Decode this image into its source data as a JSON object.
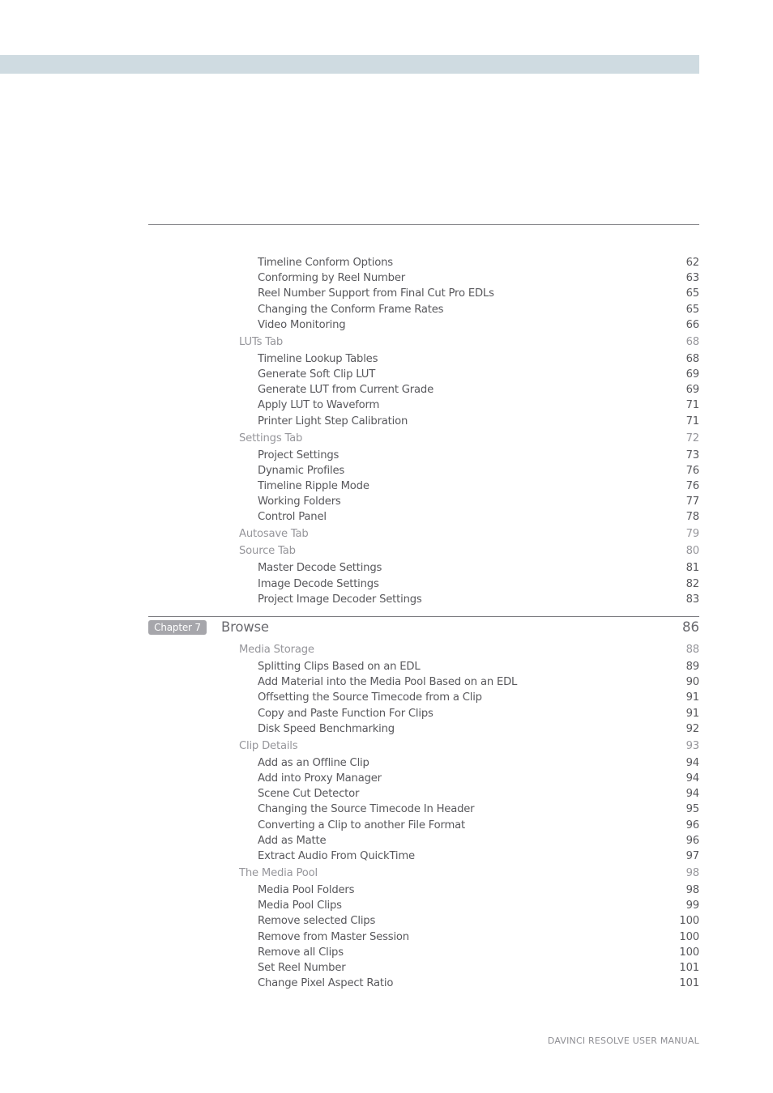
{
  "header": {
    "band_color": "#cfdbe1"
  },
  "toc_before": [
    {
      "level": "sub",
      "title": "Timeline Conform Options",
      "page": "62"
    },
    {
      "level": "sub",
      "title": "Conforming by Reel Number",
      "page": "63"
    },
    {
      "level": "sub",
      "title": "Reel Number Support from Final Cut Pro EDLs",
      "page": "65"
    },
    {
      "level": "sub",
      "title": "Changing the Conform Frame Rates",
      "page": "65"
    },
    {
      "level": "sub",
      "title": "Video Monitoring",
      "page": "66"
    },
    {
      "level": "sec",
      "title": "LUTs Tab",
      "page": "68"
    },
    {
      "level": "sub",
      "title": "Timeline Lookup Tables",
      "page": "68"
    },
    {
      "level": "sub",
      "title": "Generate Soft Clip LUT",
      "page": "69"
    },
    {
      "level": "sub",
      "title": "Generate LUT from Current Grade",
      "page": "69"
    },
    {
      "level": "sub",
      "title": "Apply LUT to Waveform",
      "page": "71"
    },
    {
      "level": "sub",
      "title": "Printer Light Step Calibration",
      "page": "71"
    },
    {
      "level": "sec",
      "title": "Settings Tab",
      "page": "72"
    },
    {
      "level": "sub",
      "title": "Project Settings",
      "page": "73"
    },
    {
      "level": "sub",
      "title": "Dynamic Profiles",
      "page": "76"
    },
    {
      "level": "sub",
      "title": "Timeline Ripple Mode",
      "page": "76"
    },
    {
      "level": "sub",
      "title": "Working Folders",
      "page": "77"
    },
    {
      "level": "sub",
      "title": "Control Panel",
      "page": "78"
    },
    {
      "level": "sec",
      "title": "Autosave Tab",
      "page": "79"
    },
    {
      "level": "sec",
      "title": "Source Tab",
      "page": "80"
    },
    {
      "level": "sub",
      "title": "Master Decode Settings",
      "page": "81"
    },
    {
      "level": "sub",
      "title": "Image Decode Settings",
      "page": "82"
    },
    {
      "level": "sub",
      "title": "Project Image Decoder Settings",
      "page": "83"
    }
  ],
  "chapter": {
    "badge": "Chapter 7",
    "title": "Browse",
    "page": "86"
  },
  "toc_after": [
    {
      "level": "sec",
      "title": "Media Storage",
      "page": "88"
    },
    {
      "level": "sub",
      "title": "Splitting Clips Based on an EDL",
      "page": "89"
    },
    {
      "level": "sub",
      "title": "Add Material into the Media Pool Based on an EDL",
      "page": "90"
    },
    {
      "level": "sub",
      "title": "Offsetting the Source Timecode from a Clip",
      "page": "91"
    },
    {
      "level": "sub",
      "title": "Copy and Paste Function For Clips",
      "page": "91"
    },
    {
      "level": "sub",
      "title": "Disk Speed Benchmarking",
      "page": "92"
    },
    {
      "level": "sec",
      "title": "Clip Details",
      "page": "93"
    },
    {
      "level": "sub",
      "title": "Add as an Offline Clip",
      "page": "94"
    },
    {
      "level": "sub",
      "title": "Add into Proxy Manager",
      "page": "94"
    },
    {
      "level": "sub",
      "title": "Scene Cut Detector",
      "page": "94"
    },
    {
      "level": "sub",
      "title": "Changing the Source Timecode In Header",
      "page": "95"
    },
    {
      "level": "sub",
      "title": "Converting a Clip to another File Format",
      "page": "96"
    },
    {
      "level": "sub",
      "title": "Add as Matte",
      "page": "96"
    },
    {
      "level": "sub",
      "title": "Extract Audio From QuickTime",
      "page": "97"
    },
    {
      "level": "sec",
      "title": "The Media Pool",
      "page": "98"
    },
    {
      "level": "sub",
      "title": "Media Pool Folders",
      "page": "98"
    },
    {
      "level": "sub",
      "title": "Media Pool Clips",
      "page": "99"
    },
    {
      "level": "sub",
      "title": "Remove selected Clips",
      "page": "100"
    },
    {
      "level": "sub",
      "title": "Remove from Master Session",
      "page": "100"
    },
    {
      "level": "sub",
      "title": "Remove all Clips",
      "page": "100"
    },
    {
      "level": "sub",
      "title": "Set Reel Number",
      "page": "101"
    },
    {
      "level": "sub",
      "title": "Change Pixel Aspect Ratio",
      "page": "101"
    }
  ],
  "footer": {
    "text": "DAVINCI RESOLVE USER MANUAL"
  }
}
